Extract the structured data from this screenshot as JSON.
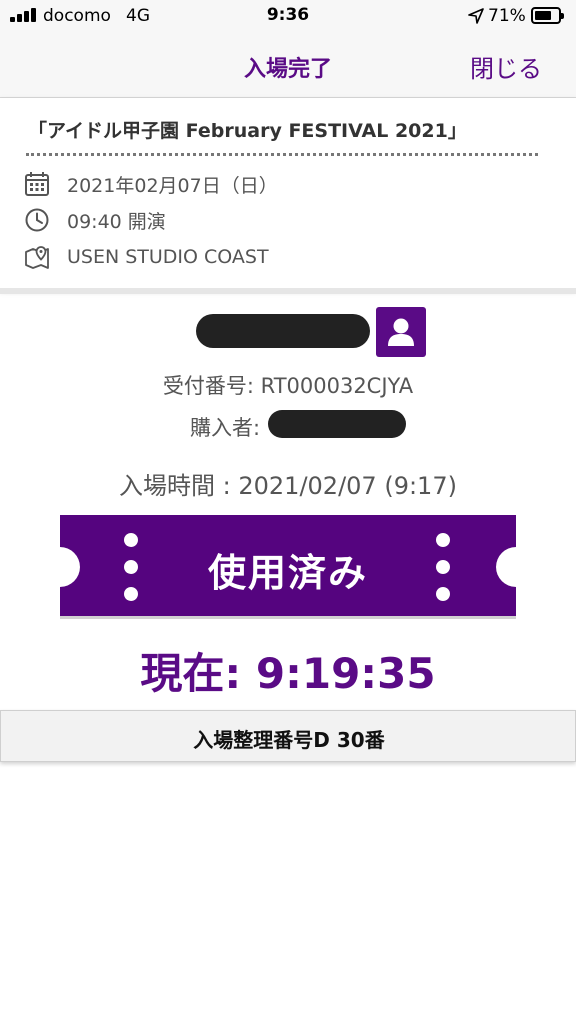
{
  "status_bar": {
    "carrier": "docomo",
    "network": "4G",
    "time": "9:36",
    "battery": "71%",
    "battery_level": 0.71,
    "icons": [
      "signal-icon",
      "location-arrow-icon",
      "battery-icon"
    ]
  },
  "nav": {
    "title": "入場完了",
    "close_label": "閉じる",
    "accent_color": "#5a0b86"
  },
  "event": {
    "title": "「アイドル甲子園 February FESTIVAL 2021」",
    "date": "2021年02月07日（日）",
    "start_time": "09:40 開演",
    "venue": "USEN STUDIO COAST",
    "icons": [
      "calendar-icon",
      "clock-icon",
      "map-pin-icon"
    ]
  },
  "ticket": {
    "reception_number": "受付番号: RT000032CJYA",
    "purchaser_label": "購入者:",
    "entry_time": "入場時間 : 2021/02/07 (9:17)",
    "status_label": "使用済み",
    "current_time": "現在: 9:19:35",
    "order_number": "入場整理番号D 30番"
  }
}
